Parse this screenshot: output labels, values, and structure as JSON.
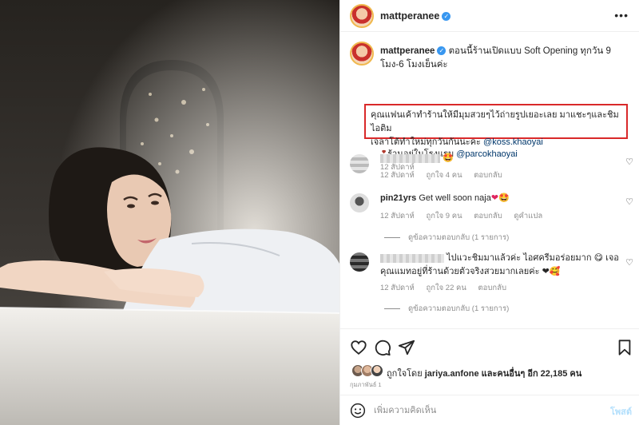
{
  "post": {
    "username": "mattperanee",
    "more_label": "•••"
  },
  "caption": {
    "username": "mattperanee",
    "line1": "ตอนนี้ร้านเปิดแบบ Soft Opening ทุกวัน 9 โมง-6 โมงเย็นค่ะ",
    "highlight_line1": "คุณแฟนเค้าทำร้านให้มีมุมสวยๆไว้ถ่ายรูปเยอะเลย มาแชะๆและชิมไอติม",
    "highlight_line2": "เจลาโต้ทำใหม่ทุกวันกันนะคะ",
    "mention": "@koss.khaoyai",
    "location_text": "ร้านอยู่ในโรงแรม",
    "location_mention": "@parcokhaoyai",
    "time": "12 สัปดาห์"
  },
  "comments": [
    {
      "text_emoji": "🤩",
      "time": "12 สัปดาห์",
      "likes": "ถูกใจ 4 คน",
      "reply": "ตอบกลับ"
    },
    {
      "username": "pin21yrs",
      "text": "Get well soon naja",
      "emoji": "❤🤩",
      "time": "12 สัปดาห์",
      "likes": "ถูกใจ 9 คน",
      "reply": "ตอบกลับ",
      "translate": "ดูคำแปล",
      "view_replies": "ดูข้อความตอบกลับ (1 รายการ)"
    },
    {
      "text_line1": "ไปแวะชิมมาแล้วค่ะ ไอศครีมอร่อยมาก 😋 เจอ",
      "text_line2": "คุณแมทอยู่ที่ร้านด้วยตัวจริงสวยมากเลยค่ะ ❤🥰",
      "time": "12 สัปดาห์",
      "likes": "ถูกใจ 22 คน",
      "reply": "ตอบกลับ",
      "view_replies": "ดูข้อความตอบกลับ (1 รายการ)"
    }
  ],
  "likes": {
    "prefix": "ถูกใจโดย",
    "user": "jariya.anfone",
    "middle": "และคนอื่นๆ อีก",
    "count": "22,185",
    "suffix": "คน",
    "date": "กุมภาพันธ์ 1"
  },
  "add_comment": {
    "placeholder": "เพิ่มความคิดเห็น",
    "post_label": "โพสต์"
  },
  "icons": {
    "more": "more-horizontal-icon",
    "heart": "heart-icon",
    "comment": "comment-icon",
    "share": "share-icon",
    "save": "bookmark-icon",
    "emoji": "emoji-icon",
    "verified": "verified-badge-icon"
  },
  "colors": {
    "highlight_border": "#d9292a",
    "verified": "#3897f0",
    "link": "#00376b",
    "muted": "#8e8e8e"
  }
}
